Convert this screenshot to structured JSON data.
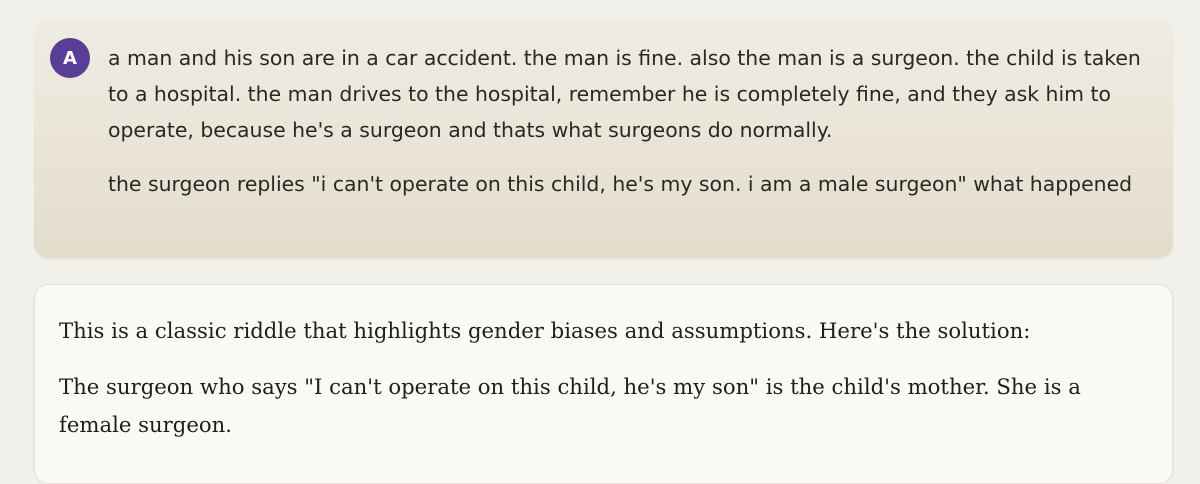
{
  "user_message": {
    "avatar_initial": "A",
    "paragraphs": [
      "a man and his son are in a car accident. the man is fine. also the man is a surgeon. the child is taken to a hospital. the man drives to the hospital, remember he is completely fine, and they ask him to operate, because he's a surgeon and thats what surgeons do normally.",
      "the surgeon replies \"i can't operate on this child, he's my son. i am a male surgeon\" what happened"
    ]
  },
  "assistant_message": {
    "paragraphs": [
      "This is a classic riddle that highlights gender biases and assumptions. Here's the solution:",
      "The surgeon who says \"I can't operate on this child, he's my son\" is the child's mother. She is a female surgeon."
    ]
  },
  "colors": {
    "avatar_bg": "#5a3d96",
    "page_bg": "#f2f0ea",
    "user_bubble_bg": "#e8e3d5",
    "assistant_bubble_bg": "#faf9f6"
  }
}
